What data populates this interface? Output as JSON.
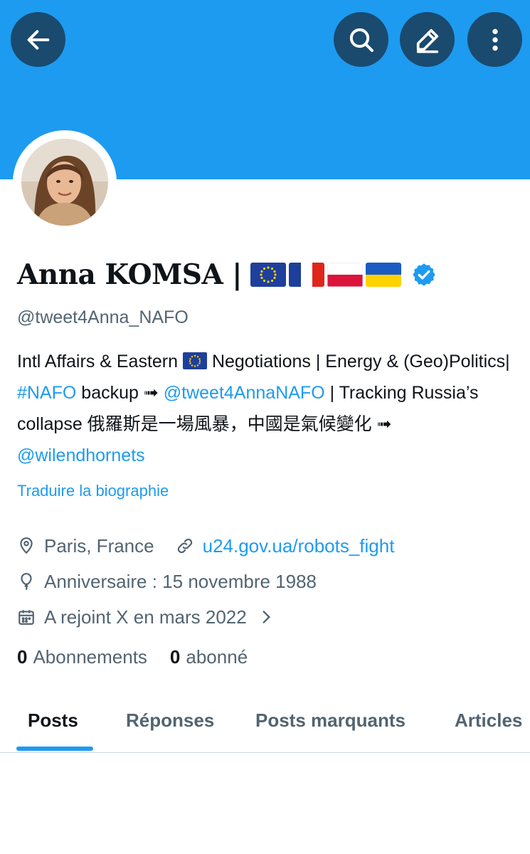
{
  "header": {
    "back_icon": "arrow-left-icon",
    "search_icon": "search-icon",
    "edit_icon": "pencil-icon",
    "more_icon": "more-vertical-icon",
    "banner_color": "#1d9bf0",
    "button_color": "#1a4a6e"
  },
  "profile": {
    "name": "Anna KOMSA |",
    "flags": [
      "EU",
      "France",
      "Poland",
      "Ukraine"
    ],
    "verified_icon": "verified-badge-icon",
    "handle": "@tweet4Anna_NAFO",
    "bio": {
      "part1": "Intl Affairs & Eastern",
      "part2": " Negotiations | Energy & (Geo)Politics| ",
      "hashtag": "#NAFO",
      "part3": " backup ➟ ",
      "mention1": "@tweet4AnnaNAFO",
      "part4": " | Tracking Russia’s collapse 俄羅斯是一場風暴，中國是氣候變化 ➟ ",
      "mention2": "@wilendhornets"
    },
    "translate_link": "Traduire la biographie",
    "location": "Paris, France",
    "website": "u24.gov.ua/robots_fight",
    "birthday": "Anniversaire : 15 novembre 1988",
    "joined": "A rejoint X en mars 2022",
    "following_count": "0",
    "following_label": "Abonnements",
    "followers_count": "0",
    "followers_label": "abonné"
  },
  "tabs": [
    {
      "label": "Posts",
      "active": true
    },
    {
      "label": "Réponses",
      "active": false
    },
    {
      "label": "Posts marquants",
      "active": false
    },
    {
      "label": "Articles",
      "active": false
    }
  ],
  "accent_color": "#1d9bf0"
}
